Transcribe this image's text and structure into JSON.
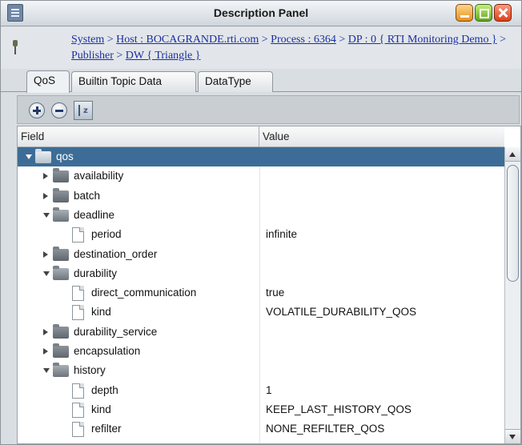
{
  "window": {
    "title": "Description Panel"
  },
  "breadcrumb": [
    {
      "label": "System",
      "link": true
    },
    {
      "label": " > ",
      "link": false
    },
    {
      "label": "Host : BOCAGRANDE.rti.com",
      "link": true
    },
    {
      "label": " > ",
      "link": false
    },
    {
      "label": "Process : 6364",
      "link": true
    },
    {
      "label": " > ",
      "link": false
    },
    {
      "label": "DP : 0 { RTI Monitoring Demo }",
      "link": true
    },
    {
      "label": " > ",
      "link": false
    },
    {
      "label": "Publisher",
      "link": true
    },
    {
      "label": " > ",
      "link": false
    },
    {
      "label": "DW { Triangle }",
      "link": true
    }
  ],
  "tabs": [
    {
      "label": "QoS",
      "active": true
    },
    {
      "label": "Builtin Topic Data",
      "active": false
    },
    {
      "label": "DataType",
      "active": false
    }
  ],
  "toolbar": {
    "expand_icon": "plus-circle-icon",
    "collapse_icon": "minus-circle-icon",
    "sort_icon": "sort-az-icon"
  },
  "table": {
    "columns": {
      "field": "Field",
      "value": "Value"
    },
    "rows": [
      {
        "field": "qos",
        "value": "",
        "level": 0,
        "type": "folder",
        "state": "expanded",
        "selected": true
      },
      {
        "field": "availability",
        "value": "",
        "level": 1,
        "type": "folder",
        "state": "collapsed"
      },
      {
        "field": "batch",
        "value": "",
        "level": 1,
        "type": "folder",
        "state": "collapsed"
      },
      {
        "field": "deadline",
        "value": "",
        "level": 1,
        "type": "folder",
        "state": "expanded"
      },
      {
        "field": "period",
        "value": "infinite",
        "level": 2,
        "type": "leaf"
      },
      {
        "field": "destination_order",
        "value": "",
        "level": 1,
        "type": "folder",
        "state": "collapsed"
      },
      {
        "field": "durability",
        "value": "",
        "level": 1,
        "type": "folder",
        "state": "expanded"
      },
      {
        "field": "direct_communication",
        "value": "true",
        "level": 2,
        "type": "leaf"
      },
      {
        "field": "kind",
        "value": "VOLATILE_DURABILITY_QOS",
        "level": 2,
        "type": "leaf"
      },
      {
        "field": "durability_service",
        "value": "",
        "level": 1,
        "type": "folder",
        "state": "collapsed"
      },
      {
        "field": "encapsulation",
        "value": "",
        "level": 1,
        "type": "folder",
        "state": "collapsed"
      },
      {
        "field": "history",
        "value": "",
        "level": 1,
        "type": "folder",
        "state": "expanded"
      },
      {
        "field": "depth",
        "value": "1",
        "level": 2,
        "type": "leaf"
      },
      {
        "field": "kind",
        "value": "KEEP_LAST_HISTORY_QOS",
        "level": 2,
        "type": "leaf"
      },
      {
        "field": "refilter",
        "value": "NONE_REFILTER_QOS",
        "level": 2,
        "type": "leaf"
      }
    ]
  },
  "colors": {
    "selected_row": "#3d6d96",
    "link": "#1b2fa0"
  }
}
